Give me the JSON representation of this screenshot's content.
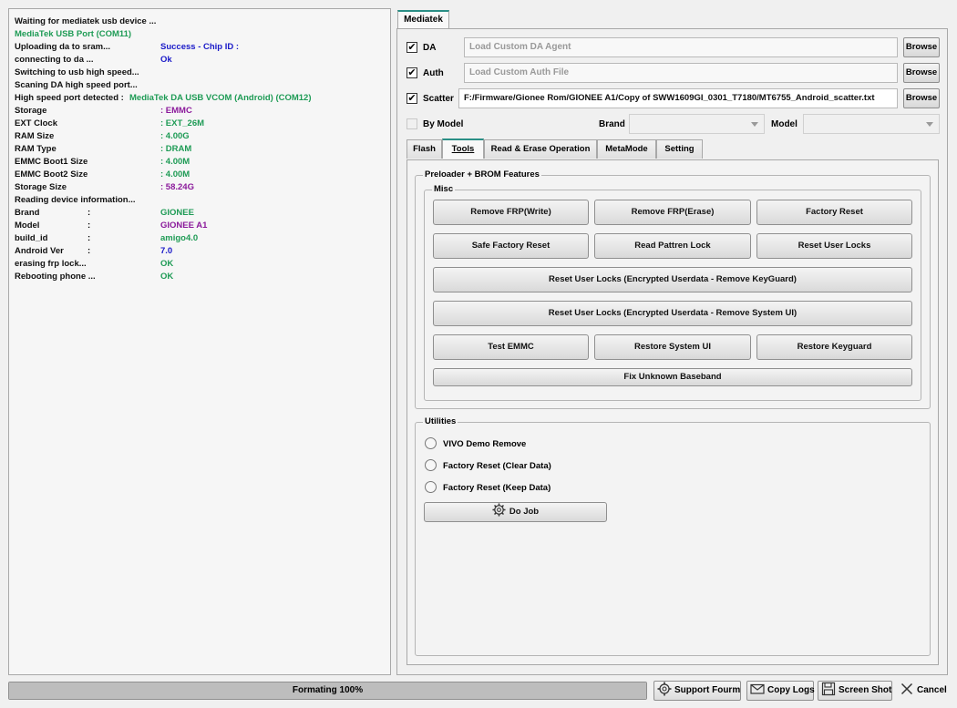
{
  "log": [
    {
      "key": "Waiting for mediatek usb device ...",
      "key_color": "black"
    },
    {
      "key": "MediaTek USB Port (COM11)",
      "key_color": "green"
    },
    {
      "key": "Uploading da to sram...",
      "key_color": "black",
      "value": "Success - Chip ID  :",
      "value_color": "blue"
    },
    {
      "key": "connecting to da ...",
      "key_color": "black",
      "value": "Ok",
      "value_color": "blue"
    },
    {
      "key": "Switching to usb high speed...",
      "key_color": "black"
    },
    {
      "key": "Scaning DA high speed port...",
      "key_color": "black"
    },
    {
      "key": "High speed port detected : ",
      "key_color": "black",
      "inline": "MediaTek DA USB VCOM (Android) (COM12)",
      "inline_color": "green"
    },
    {
      "key": "Storage",
      "key_color": "black",
      "value": ": EMMC",
      "value_color": "purple"
    },
    {
      "key": "EXT Clock",
      "key_color": "black",
      "value": ": EXT_26M",
      "value_color": "green"
    },
    {
      "key": "RAM Size",
      "key_color": "black",
      "value": ": 4.00G",
      "value_color": "green"
    },
    {
      "key": "RAM Type",
      "key_color": "black",
      "value": ": DRAM",
      "value_color": "green"
    },
    {
      "key": "EMMC Boot1 Size",
      "key_color": "black",
      "value": ": 4.00M",
      "value_color": "green"
    },
    {
      "key": "EMMC Boot2 Size",
      "key_color": "black",
      "value": ": 4.00M",
      "value_color": "green"
    },
    {
      "key": "Storage Size",
      "key_color": "black",
      "value": ": 58.24G",
      "value_color": "purple"
    },
    {
      "key": "Reading device information...",
      "key_color": "black"
    },
    {
      "key": "Brand",
      "key_color": "black",
      "sep": ":",
      "value": "GIONEE",
      "value_color": "green"
    },
    {
      "key": "Model",
      "key_color": "black",
      "sep": ":",
      "value": "GIONEE A1",
      "value_color": "purple"
    },
    {
      "key": "build_id",
      "key_color": "black",
      "sep": ":",
      "value": "amigo4.0",
      "value_color": "green"
    },
    {
      "key": "Android Ver",
      "key_color": "black",
      "sep": ":",
      "value": "7.0",
      "value_color": "blue"
    },
    {
      "key": "erasing frp lock...",
      "key_color": "black",
      "value": "OK",
      "value_color": "green"
    },
    {
      "key": "Rebooting phone ...",
      "key_color": "black",
      "value": "OK",
      "value_color": "green"
    }
  ],
  "colors": {
    "green": "#1e9b55",
    "blue": "#1a1ac8",
    "purple": "#8b1a9b",
    "black": "#111111",
    "accent": "#2a8f86"
  },
  "tabs": {
    "main": "Mediatek"
  },
  "da": {
    "label": "DA",
    "checked": "✔",
    "placeholder": "Load Custom DA Agent",
    "browse": "Browse"
  },
  "auth": {
    "label": "Auth",
    "checked": "✔",
    "placeholder": "Load Custom Auth File",
    "browse": "Browse"
  },
  "scatter": {
    "label": "Scatter",
    "checked": "✔",
    "value": "F:/Firmware/Gionee Rom/GIONEE A1/Copy of SWW1609GI_0301_T7180/MT6755_Android_scatter.txt",
    "browse": "Browse"
  },
  "by_model": {
    "label": "By Model",
    "brand_label": "Brand",
    "model_label": "Model"
  },
  "inner_tabs": {
    "flash": "Flash",
    "tools": "Tools",
    "read_erase": "Read & Erase Operation",
    "metamode": "MetaMode",
    "setting": "Setting"
  },
  "preloader": {
    "title": "Preloader + BROM Features"
  },
  "misc": {
    "title": "Misc",
    "remove_frp_write": "Remove FRP(Write)",
    "remove_frp_erase": "Remove FRP(Erase)",
    "factory_reset": "Factory Reset",
    "safe_factory_reset": "Safe Factory Reset",
    "read_pattern_lock": "Read Pattren Lock",
    "reset_user_locks": "Reset User Locks",
    "reset_keyguard": "Reset User Locks (Encrypted Userdata - Remove KeyGuard)",
    "reset_systemui": "Reset User Locks (Encrypted Userdata - Remove System UI)",
    "test_emmc": "Test EMMC",
    "restore_systemui": "Restore System UI",
    "restore_keyguard": "Restore Keyguard",
    "fix_baseband": "Fix Unknown Baseband"
  },
  "utilities": {
    "title": "Utilities",
    "vivo": "VIVO Demo Remove",
    "fr_clear": "Factory Reset (Clear Data)",
    "fr_keep": "Factory Reset (Keep Data)",
    "do_job": "Do Job"
  },
  "status": {
    "progress_text": "Formating 100%",
    "progress": 1.0
  },
  "bottom": {
    "support": "Support Fourm",
    "copy_logs": "Copy Logs",
    "screenshot": "Screen Shot",
    "cancel": "Cancel"
  }
}
